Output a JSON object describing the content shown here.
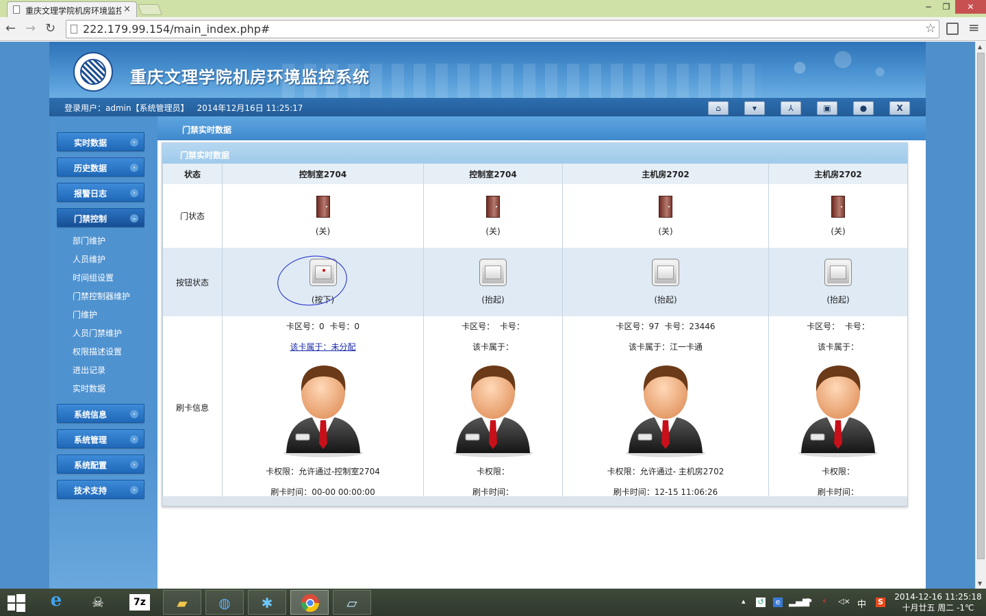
{
  "browser": {
    "tab_title": "重庆文理学院机房环境监控",
    "tab_close": "×",
    "url": "222.179.99.154/main_index.php#",
    "back": "←",
    "forward": "→",
    "reload": "↻",
    "star": "☆",
    "menu": "≡",
    "win_min": "−",
    "win_max": "❐",
    "win_close": "✕"
  },
  "header": {
    "title": "重庆文理学院机房环境监控系统",
    "login_info": "登录用户：admin【系统管理员】",
    "datetime": "2014年12月16日 11:25:17",
    "buttons": [
      {
        "name": "home-icon",
        "glyph": "⌂"
      },
      {
        "name": "shirt-icon",
        "glyph": "▾"
      },
      {
        "name": "network-icon",
        "glyph": "⅄"
      },
      {
        "name": "image-icon",
        "glyph": "▣"
      },
      {
        "name": "user-icon",
        "glyph": "●"
      },
      {
        "name": "exit-icon",
        "glyph": "X"
      }
    ]
  },
  "sidebar": {
    "menus": [
      {
        "label": "实时数据",
        "arrow": "›"
      },
      {
        "label": "历史数据",
        "arrow": "›"
      },
      {
        "label": "报警日志",
        "arrow": "›"
      },
      {
        "label": "门禁控制",
        "arrow": "⌄"
      }
    ],
    "subitems": [
      "部门维护",
      "人员维护",
      "时间组设置",
      "门禁控制器维护",
      "门维护",
      "人员门禁维护",
      "权限描述设置",
      "进出记录",
      "实时数据"
    ],
    "menus_bottom": [
      {
        "label": "系统信息",
        "arrow": "›"
      },
      {
        "label": "系统管理",
        "arrow": "›"
      },
      {
        "label": "系统配置",
        "arrow": "›"
      },
      {
        "label": "技术支持",
        "arrow": "›"
      }
    ]
  },
  "breadcrumb": "门禁实时数据",
  "panel": {
    "title": "门禁实时数据",
    "status_header": "状态",
    "row_labels": {
      "door": "门状态",
      "button": "按钮状态",
      "card": "刷卡信息"
    },
    "doors": [
      {
        "name": "控制室2704",
        "door_state": "(关)",
        "button_state": "(按下)",
        "button_pressed": true,
        "card_area": "卡区号：0",
        "card_no": "卡号：0",
        "owner": "该卡属于：未分配",
        "owner_link": true,
        "permission": "卡权限：允许通过-控制室2704",
        "swipe_time": "刷卡时间：00-00 00:00:00"
      },
      {
        "name": "控制室2704",
        "door_state": "(关)",
        "button_state": "(抬起)",
        "button_pressed": false,
        "card_area": "卡区号：",
        "card_no": "卡号：",
        "owner": "该卡属于：",
        "owner_link": false,
        "permission": "卡权限：",
        "swipe_time": "刷卡时间："
      },
      {
        "name": "主机房2702",
        "door_state": "(关)",
        "button_state": "(抬起)",
        "button_pressed": false,
        "card_area": "卡区号：97",
        "card_no": "卡号：23446",
        "owner": "该卡属于：江一卡通",
        "owner_link": false,
        "permission": "卡权限：允许通过- 主机房2702",
        "swipe_time": "刷卡时间：12-15 11:06:26"
      },
      {
        "name": "主机房2702",
        "door_state": "(关)",
        "button_state": "(抬起)",
        "button_pressed": false,
        "card_area": "卡区号：",
        "card_no": "卡号：",
        "owner": "该卡属于：",
        "owner_link": false,
        "permission": "卡权限：",
        "swipe_time": "刷卡时间："
      }
    ]
  },
  "taskbar": {
    "clock_date": "2014-12-16  11:25:18",
    "clock_lunar": "十月廿五 周二 -1℃",
    "ime": "中",
    "sogou": "S"
  }
}
